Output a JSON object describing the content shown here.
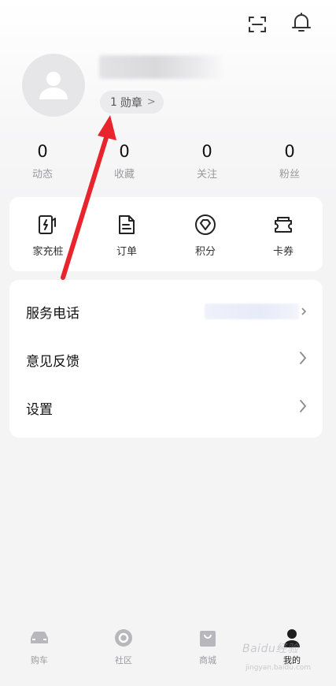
{
  "header": {
    "scan_icon": "scan-icon",
    "bell_icon": "bell-icon"
  },
  "profile": {
    "badge_count": "1",
    "badge_label": "勋章",
    "badge_chevron": ">"
  },
  "stats": [
    {
      "value": "0",
      "label": "动态"
    },
    {
      "value": "0",
      "label": "收藏"
    },
    {
      "value": "0",
      "label": "关注"
    },
    {
      "value": "0",
      "label": "粉丝"
    }
  ],
  "quick_actions": [
    {
      "label": "家充桩",
      "icon": "charger-icon"
    },
    {
      "label": "订单",
      "icon": "order-icon"
    },
    {
      "label": "积分",
      "icon": "points-icon"
    },
    {
      "label": "卡券",
      "icon": "coupon-icon"
    }
  ],
  "menu": [
    {
      "label": "服务电话"
    },
    {
      "label": "意见反馈"
    },
    {
      "label": "设置"
    }
  ],
  "tabbar": [
    {
      "label": "购车",
      "icon": "car-icon"
    },
    {
      "label": "社区",
      "icon": "community-icon"
    },
    {
      "label": "商城",
      "icon": "shop-icon"
    },
    {
      "label": "我的",
      "icon": "profile-icon"
    }
  ],
  "watermark": {
    "text": "Baidu经验",
    "sub": "jingyan.baidu.com"
  },
  "colors": {
    "background": "#f4f4f5",
    "card": "#ffffff",
    "arrow": "#e8242c",
    "muted_text": "#9a9a9e"
  }
}
